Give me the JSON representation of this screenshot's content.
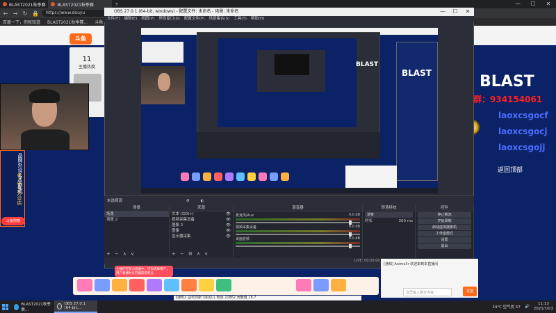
{
  "browser": {
    "tabs": [
      {
        "label": "BLAST2021秋季赛"
      },
      {
        "label": "BLAST2021秋季赛"
      }
    ],
    "new_tab": "+",
    "url": "https://www.douyu",
    "bookmarks": [
      "百度一下，你就知道",
      "BLAST2021秋季赛...",
      "斗鱼 - 每个人..."
    ],
    "window_controls": [
      "—",
      "☐",
      "✕"
    ]
  },
  "site": {
    "logo_text": "斗鱼",
    "heat_label": "主播热度",
    "heat_value": "11",
    "ad_text": "品牌外设 专业配机",
    "ad_text2": "老X电竞外设店",
    "ad_button": "斗鱼购物",
    "blast_logo": "BLAST",
    "right_nav": [
      "返回顶部"
    ],
    "chat_overlay": [
      "水友群：934154061",
      "laoxcsgocf",
      "laoxcsgocj",
      "laoxcsgojj"
    ],
    "notice": "主播还在努力直播中，可去选择用户，用户看播时长开播获得积分",
    "chat_line": "[通知] Anime3r 欢迎来到本直播间",
    "chat_placeholder": "这里输入聊天内容",
    "send": "发送",
    "stats": "【通知】@可你斯飞机幼儿   粉丝 21862   贡献值 18.7"
  },
  "obs": {
    "title": "OBS 27.0.1 (64-bit, windows) - 配置文件: 未命名 - 场景: 未命名",
    "menu": [
      "文件(F)",
      "编辑(E)",
      "视图(V)",
      "停靠窗口(D)",
      "配置文件(P)",
      "场景集合(S)",
      "工具(T)",
      "帮助(H)"
    ],
    "selection_bar": "未选择源",
    "scenes_header": "场景",
    "scenes": [
      "场景",
      "场景 2"
    ],
    "sources_header": "来源",
    "sources": [
      "文本 (GDI+)",
      "视频采集设备",
      "图像 2",
      "图像",
      "显示器采集"
    ],
    "mixer_header": "混音器",
    "mixer": [
      {
        "name": "麦克风/Aux",
        "db": "0.0 dB"
      },
      {
        "name": "视频采集设备",
        "db": "0.0 dB"
      },
      {
        "name": "桌面音频",
        "db": "0.0 dB"
      }
    ],
    "transition_header": "转场特效",
    "transition_type": "渐变",
    "transition_duration_label": "时长",
    "transition_duration": "300 ms",
    "controls_header": "控件",
    "controls": [
      "停止推流",
      "开始录制",
      "启动虚拟摄像机",
      "工作室模式",
      "设置",
      "退出"
    ],
    "status": "LIVE: 00:00:00   REC: 00:00:00   CPU: 0.0%, 30.00 fps",
    "window_controls": [
      "—",
      "☐",
      "✕"
    ]
  },
  "taskbar": {
    "apps": [
      "BLAST2021秋季赛...",
      "OBS 27.0.1 (64-bit..."
    ],
    "weather": "24°C 空气优 57",
    "clock_time": "11:13",
    "clock_date": "2021/10/3"
  }
}
